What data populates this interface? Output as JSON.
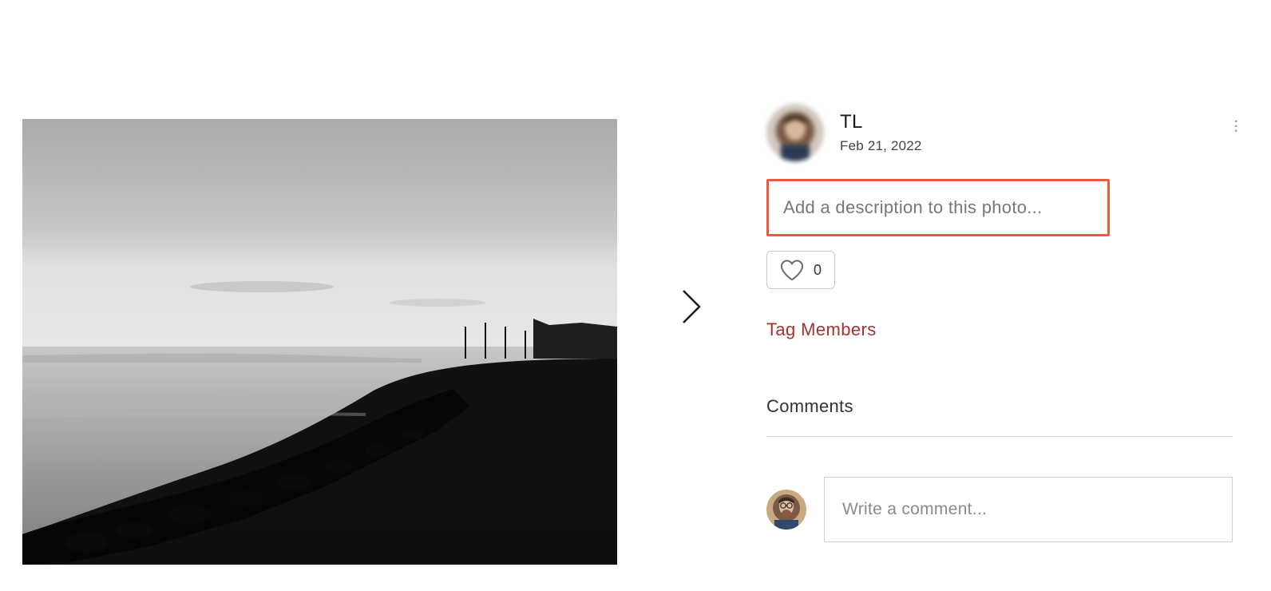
{
  "author": {
    "name": "TL",
    "date": "Feb 21, 2022"
  },
  "description": {
    "placeholder": "Add a description to this photo..."
  },
  "likes": {
    "count": "0"
  },
  "actions": {
    "tag_members": "Tag Members"
  },
  "comments": {
    "heading": "Comments",
    "input_placeholder": "Write a comment..."
  }
}
